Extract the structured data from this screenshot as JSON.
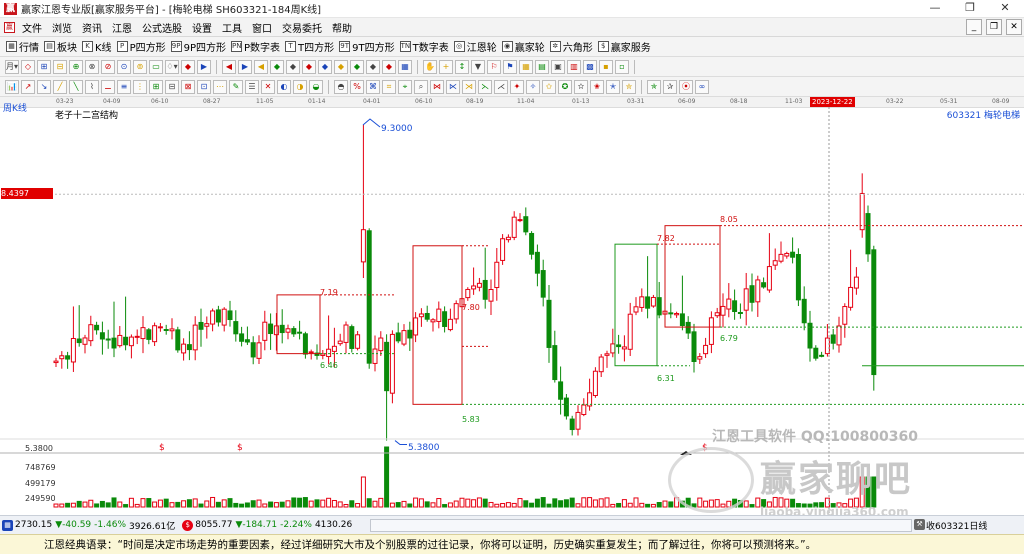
{
  "window": {
    "title": "赢家江恩专业版[赢家服务平台] - [梅轮电梯  SH603321-184周K线]",
    "app_icon_text": "赢",
    "controls": [
      "—",
      "❐",
      "✕"
    ]
  },
  "menu": {
    "items": [
      "文件",
      "浏览",
      "资讯",
      "江恩",
      "公式选股",
      "设置",
      "工具",
      "窗口",
      "交易委托",
      "帮助"
    ],
    "mdi_controls": [
      "_",
      "❐",
      "✕"
    ]
  },
  "toolbar1": [
    {
      "icon": "grid-icon",
      "glyph": "▦",
      "label": "行情"
    },
    {
      "icon": "blocks-icon",
      "glyph": "▤",
      "label": "板块"
    },
    {
      "icon": "kline-icon",
      "glyph": "K",
      "label": "K线"
    },
    {
      "icon": "p-square-icon",
      "glyph": "P",
      "label": "P四方形"
    },
    {
      "icon": "9p-square-icon",
      "glyph": "9P",
      "label": "9P四方形"
    },
    {
      "icon": "pn-icon",
      "glyph": "PN",
      "label": "P数字表"
    },
    {
      "icon": "t-square-icon",
      "glyph": "T",
      "label": "T四方形"
    },
    {
      "icon": "9t-square-icon",
      "glyph": "9T",
      "label": "9T四方形"
    },
    {
      "icon": "tn-icon",
      "glyph": "TN",
      "label": "T数字表"
    },
    {
      "icon": "gann-wheel-icon",
      "glyph": "◎",
      "label": "江恩轮"
    },
    {
      "icon": "winner-wheel-icon",
      "glyph": "◉",
      "label": "赢家轮"
    },
    {
      "icon": "hexagon-icon",
      "glyph": "✲",
      "label": "六角形"
    },
    {
      "icon": "service-icon",
      "glyph": "$",
      "label": "赢家服务"
    }
  ],
  "toolbar2_groups": [
    [
      "月▾",
      "◇",
      "⊞",
      "⊟",
      "⊕",
      "⊗",
      "⊘",
      "⊙",
      "⊚",
      "▭",
      "♢▾",
      "◆",
      "▶"
    ],
    [
      "◀",
      "▶",
      "◀",
      "◆",
      "◆",
      "◆",
      "◆",
      "◆",
      "◆",
      "◆",
      "◆",
      "▦"
    ],
    [
      "✋",
      "+",
      "↕",
      "▼",
      "⚐",
      "⚑",
      "▦",
      "▤",
      "▣",
      "▥",
      "▩",
      "▪",
      "▫"
    ]
  ],
  "toolbar3_icons": [
    "📊",
    "↗",
    "↘",
    "╱",
    "╲",
    "⌇",
    "⚊",
    "≡",
    "⋮",
    "⊞",
    "⊟",
    "⊠",
    "⊡",
    "⋯",
    "✎",
    "☰",
    "✕",
    "◐",
    "◑",
    "◒",
    "◓",
    "%",
    "⌘",
    "⌗",
    "⌖",
    "⌕",
    "⋈",
    "⋉",
    "⋊",
    "⋋",
    "⋌",
    "✦",
    "✧",
    "✩",
    "✪",
    "✫",
    "✬",
    "✭",
    "✮",
    "✯",
    "✰",
    "⦿",
    "∞"
  ],
  "date_axis": {
    "labels": [
      "03-23",
      "04-09",
      "06-10",
      "08-27",
      "11-05",
      "01-14",
      "04-01",
      "06-10",
      "08-19",
      "11-04",
      "01-13",
      "03-31",
      "06-09",
      "08-18",
      "11-03",
      "2023-12-22",
      "03-22",
      "05-31",
      "08-09"
    ],
    "highlight_label": "2023-12-22"
  },
  "chart": {
    "period_label": "周K线",
    "study_title": "老子十二宫结构",
    "symbol": "603321  梅轮电梯",
    "price_box_label": "8.4397",
    "high_label": "9.3000",
    "low_label": "5.3800",
    "axis_low_label": "5.3800",
    "box_labels": [
      "7.19",
      "6.46",
      "7.80",
      "5.83",
      "7.82",
      "8.05",
      "6.79",
      "6.31"
    ],
    "volume_axis_labels": [
      "748769",
      "499179",
      "249590"
    ],
    "dollar_markers": [
      "$",
      "$",
      "$"
    ],
    "watermark_top": "江恩工具软件  QQ:100800360",
    "watermark_big": "赢家聊吧",
    "watermark_url": "liaoba.yingjia360.com",
    "colors": {
      "up": "#e60012",
      "down": "#0a8a0a",
      "box_red": "#d01010",
      "box_green": "#1e9a1e",
      "axis_line": "#b0b0b0"
    }
  },
  "status": {
    "sh_index": "2730.15",
    "sh_change": "▼-40.59",
    "sh_pct": "-1.46%",
    "sh_amount": "3926.61亿",
    "sz_index": "8055.77",
    "sz_change": "▼-184.71",
    "sz_pct": "-2.24%",
    "sz_amount": "4130.26",
    "right_text": "收603321日线"
  },
  "quote": "江恩经典语录：“时间是决定市场走势的重要因素，经过详细研究大市及个别股票的过往记录，你将可以证明，历史确实重复发生；而了解过往，你将可以预测将来。”。"
}
